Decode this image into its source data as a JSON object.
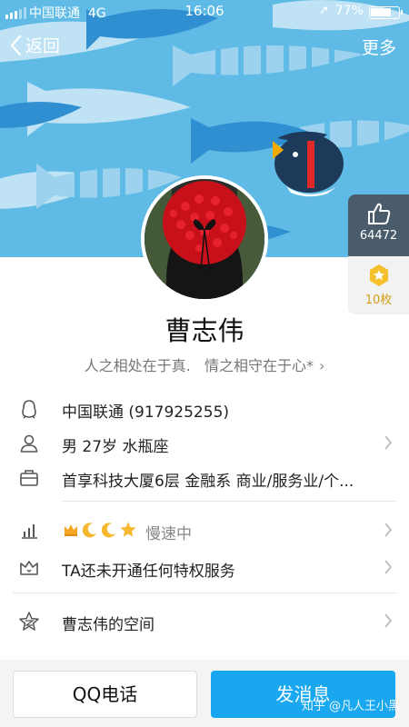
{
  "status_bar": {
    "carrier": "中国联通",
    "network": "4G",
    "time": "16:06",
    "battery_percent": "77%",
    "battery_level": 0.77
  },
  "nav": {
    "back_label": "返回",
    "more_label": "更多"
  },
  "like_badge": {
    "count": "64472",
    "icon": "thumbs-up-icon"
  },
  "coin_badge": {
    "count": "10枚",
    "icon": "star-medal-icon"
  },
  "profile": {
    "name": "曹志伟",
    "signature": "人之相处在于真.   情之相守在于心*"
  },
  "info": {
    "qq": "中国联通 (917925255)",
    "basic": "男 27岁 水瓶座",
    "work": "首享科技大厦6层 金融系 商业/服务业/个...",
    "level_status": "慢速中",
    "privilege": "TA还未开通任何特权服务",
    "space": "曹志伟的空间"
  },
  "bottom": {
    "call_label": "QQ电话",
    "message_label": "发消息",
    "watermark": "知乎 @凡人王小黑"
  },
  "colors": {
    "cover_bg": "#5fbbe6",
    "accent_blue": "#19a8f0",
    "coin_gold": "#d4a017"
  }
}
